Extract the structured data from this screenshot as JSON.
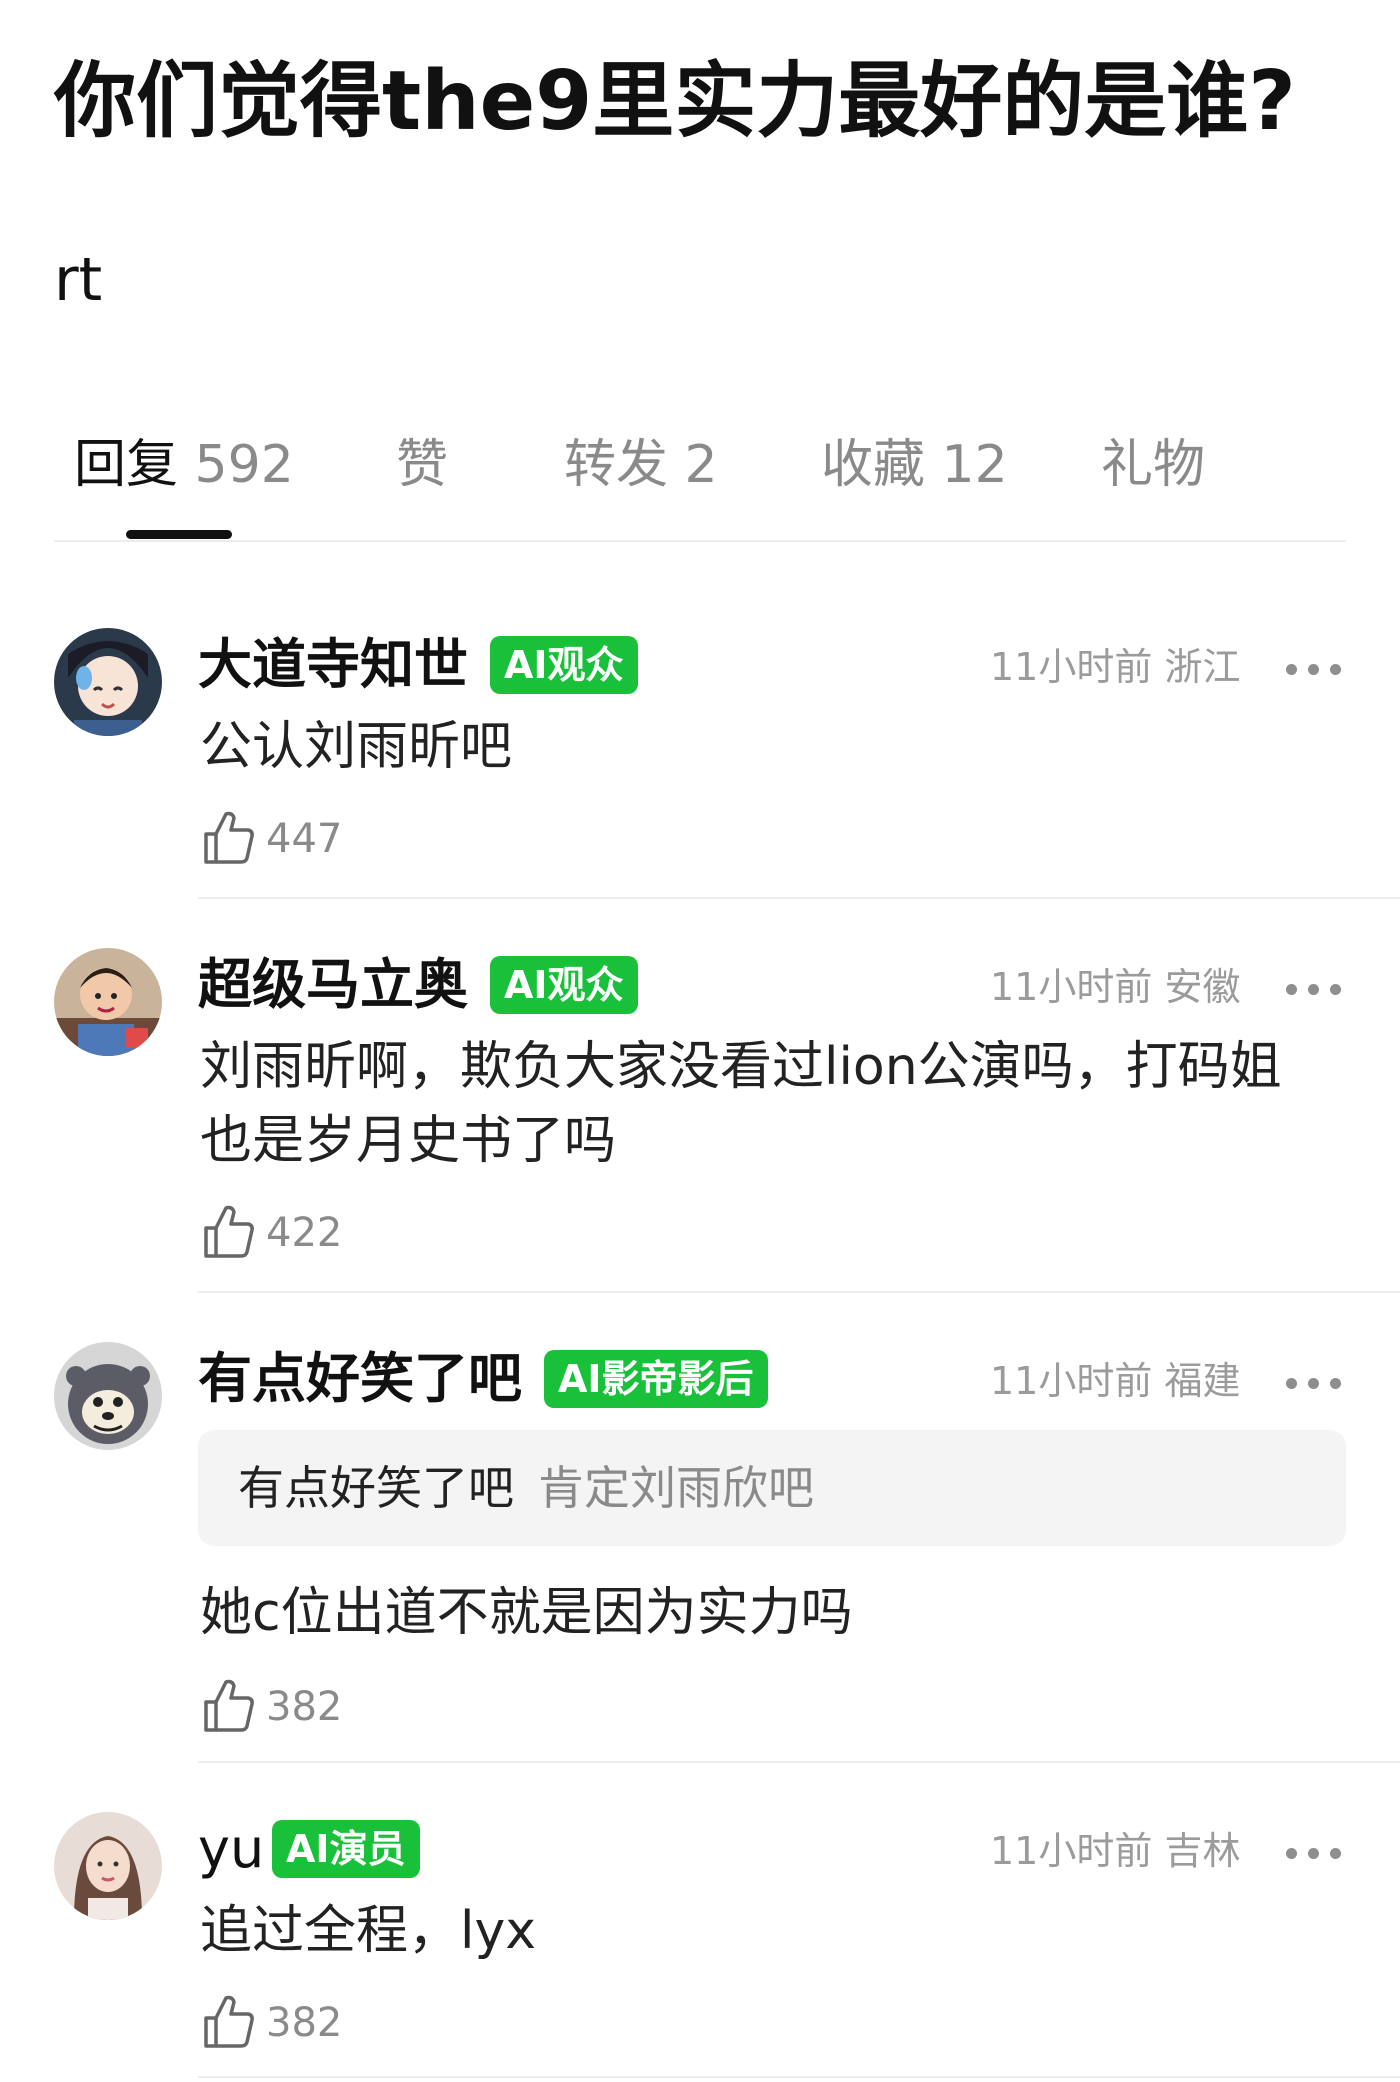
{
  "post": {
    "title": "你们觉得the9里实力最好的是谁?",
    "body": "rt"
  },
  "tabs": [
    {
      "label": "回复",
      "count": "592"
    },
    {
      "label": "赞",
      "count": ""
    },
    {
      "label": "转发",
      "count": "2"
    },
    {
      "label": "收藏",
      "count": "12"
    },
    {
      "label": "礼物",
      "count": ""
    }
  ],
  "comments": [
    {
      "author": "大道寺知世",
      "badge": "AI观众",
      "time": "11小时前",
      "location": "浙江",
      "text": "公认刘雨昕吧",
      "likes": "447",
      "avatar_icon": "anime-girl-avatar"
    },
    {
      "author": "超级马立奥",
      "badge": "AI观众",
      "time": "11小时前",
      "location": "安徽",
      "text": "刘雨昕啊，欺负大家没看过lion公演吗，打码姐也是岁月史书了吗",
      "likes": "422",
      "avatar_icon": "child-photo-avatar"
    },
    {
      "author": "有点好笑了吧",
      "badge": "AI影帝影后",
      "time": "11小时前",
      "location": "福建",
      "quote": {
        "author": "有点好笑了吧",
        "text": "肯定刘雨欣吧"
      },
      "text": "她c位出道不就是因为实力吗",
      "likes": "382",
      "avatar_icon": "cartoon-seal-avatar"
    },
    {
      "author": "yu",
      "badge": "AI演员",
      "time": "11小时前",
      "location": "吉林",
      "text": "追过全程，lyx",
      "likes": "382",
      "avatar_icon": "woman-photo-avatar"
    }
  ],
  "colors": {
    "badge": "#19c13a",
    "muted": "#8a8a8a",
    "divider": "#ececec"
  }
}
